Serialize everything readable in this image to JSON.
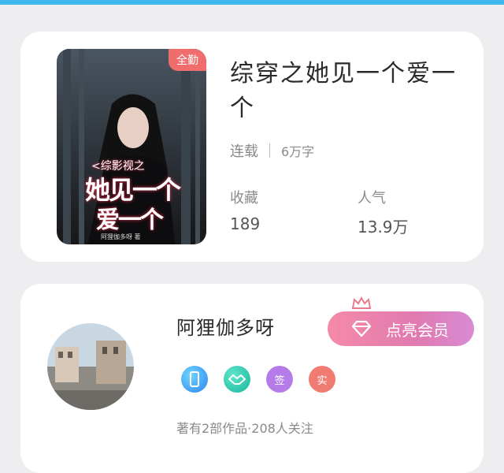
{
  "book": {
    "badge": "全勤",
    "cover_subtitle": "<综影视之",
    "cover_title_line1": "她见一个",
    "cover_title_line2": "爱一个",
    "cover_author": "阿狸伽多呀 著",
    "title": "综穿之她见一个爱一个",
    "status": "连载",
    "word_count": "6万字",
    "favorites_label": "收藏",
    "favorites_value": "189",
    "popularity_label": "人气",
    "popularity_value": "13.9万"
  },
  "author": {
    "name": "阿狸伽多呀",
    "vip_button": "点亮会员",
    "badges": [
      {
        "icon": "phone-badge-icon",
        "label": ""
      },
      {
        "icon": "handshake-badge-icon",
        "label": ""
      },
      {
        "icon": "sign-badge-icon",
        "label": "签"
      },
      {
        "icon": "real-name-badge-icon",
        "label": "实"
      }
    ],
    "stats": "著有2部作品·208人关注"
  },
  "colors": {
    "topbar": "#3fb8ee",
    "badge": "#ef6d6d",
    "vip_gradient_start": "#f58aa7",
    "vip_gradient_end": "#d88bd4"
  }
}
